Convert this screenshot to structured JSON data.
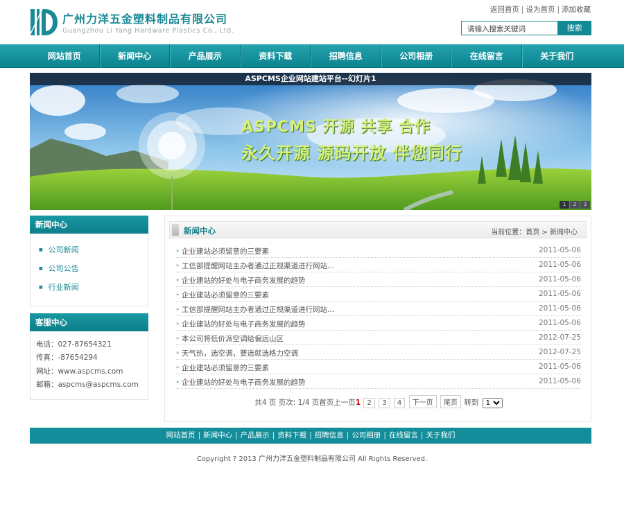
{
  "header": {
    "company_cn": "广州力洋五金塑料制品有限公司",
    "company_en": "Guangzhou Li Yang Hardware Plastics Co., Ltd.",
    "top_links": [
      "返回首页",
      "设为首页",
      "添加收藏"
    ],
    "search_placeholder": "请输入搜索关键词",
    "search_button": "搜索"
  },
  "nav": [
    "网站首页",
    "新闻中心",
    "产品展示",
    "资料下载",
    "招聘信息",
    "公司相册",
    "在线留言",
    "关于我们"
  ],
  "banner": {
    "title": "ASPCMS企业网站建站平台--幻灯片1",
    "slogan_line1": "ASPCMS 开源  共享  合作",
    "slogan_line2": "永久开源 源码开放 伴您同行",
    "dots": [
      "1",
      "2",
      "3"
    ]
  },
  "sidebar": {
    "category_title": "新闻中心",
    "categories": [
      "公司新闻",
      "公司公告",
      "行业新闻"
    ],
    "service_title": "客服中心",
    "contacts": [
      "电话：027-87654321",
      "传真：-87654294",
      "网址：www.aspcms.com",
      "邮箱：aspcms@aspcms.com"
    ]
  },
  "main": {
    "title": "新闻中心",
    "breadcrumb": "当前位置：首页 > 新闻中心",
    "news": [
      {
        "title": "企业建站必须留意的三要素",
        "date": "2011-05-06"
      },
      {
        "title": "工信部提醒网站主办者通过正规渠道进行网站...",
        "date": "2011-05-06"
      },
      {
        "title": "企业建站的好处与电子商务发展的趋势",
        "date": "2011-05-06"
      },
      {
        "title": "企业建站必须留意的三要素",
        "date": "2011-05-06"
      },
      {
        "title": "工信部提醒网站主办者通过正规渠道进行网站...",
        "date": "2011-05-06"
      },
      {
        "title": "企业建站的好处与电子商务发展的趋势",
        "date": "2011-05-06"
      },
      {
        "title": "本公司将低价派空调给偏远山区",
        "date": "2012-07-25"
      },
      {
        "title": "天气热，选空调，要选就选格力空调",
        "date": "2012-07-25"
      },
      {
        "title": "企业建站必须留意的三要素",
        "date": "2011-05-06"
      },
      {
        "title": "企业建站的好处与电子商务发展的趋势",
        "date": "2011-05-06"
      }
    ],
    "pager": {
      "summary": "共4 页 页次: 1/4 页首页上一页",
      "current": "1",
      "pages": [
        "2",
        "3",
        "4"
      ],
      "next": "下一页",
      "last": "尾页",
      "goto_label": "转到",
      "goto_value": "1"
    }
  },
  "footer": {
    "links": [
      "网站首页",
      "新闻中心",
      "产品展示",
      "资料下载",
      "招聘信息",
      "公司相册",
      "在线留言",
      "关于我们"
    ],
    "copyright": "Copyright ? 2013 广州力洋五金塑料制品有限公司 All Rights Reserved."
  }
}
